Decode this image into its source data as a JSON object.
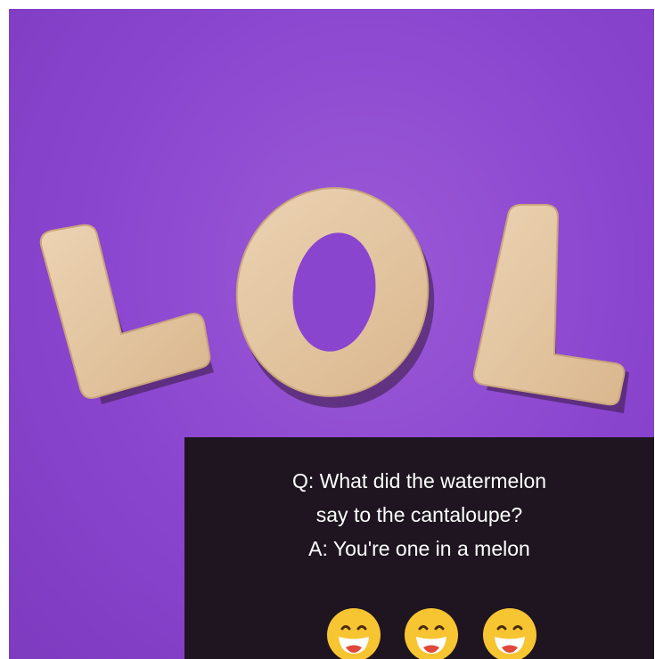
{
  "image": {
    "background_color": "#8a45cf",
    "letters": "LOL",
    "letter_material": "wood"
  },
  "caption": {
    "line1": "Q: What did the watermelon",
    "line2": "say to the cantaloupe?",
    "line3": "A: You're one in a melon"
  },
  "emojis": [
    "grinning-face-icon",
    "grinning-face-icon",
    "grinning-face-icon"
  ],
  "colors": {
    "caption_bg": "#1e1520",
    "caption_text": "#ffffff",
    "wood": "#e3c7a3",
    "emoji": "#f7c531"
  }
}
